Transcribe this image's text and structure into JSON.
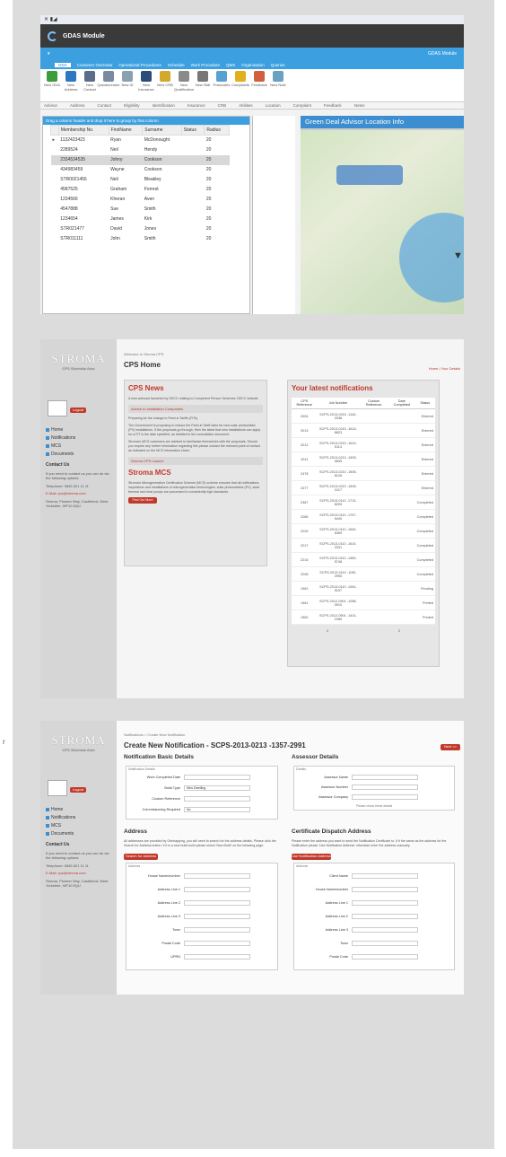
{
  "edge_char": "r",
  "gdas": {
    "window_title": "GDAS Module",
    "banner_right": "GDAS Module",
    "tabs": [
      "GDA",
      "Customer Overview",
      "Operational Procedures",
      "Schedule",
      "Work Procedure",
      "QMS",
      "Organisation",
      "Queries"
    ],
    "ribbon_buttons": [
      {
        "label": "New GDA",
        "color": "#3a9e3a"
      },
      {
        "label": "New Address",
        "color": "#2e78c2"
      },
      {
        "label": "New Contact",
        "color": "#5a6d8a"
      },
      {
        "label": "Questionnaire",
        "color": "#7a8aa0"
      },
      {
        "label": "New ID",
        "color": "#8aa0b0"
      },
      {
        "label": "New Insurance",
        "color": "#2b4c7a"
      },
      {
        "label": "New CRB",
        "color": "#d4a82a"
      },
      {
        "label": "New Qualification",
        "color": "#8a8a8a"
      },
      {
        "label": "New Skill",
        "color": "#777"
      },
      {
        "label": "Postcodes",
        "color": "#5aa0d0"
      },
      {
        "label": "Complaints",
        "color": "#e0b020"
      },
      {
        "label": "Feedback",
        "color": "#d06040"
      },
      {
        "label": "New Note",
        "color": "#6aa0c0"
      }
    ],
    "ribbon_groups": [
      "Advisor",
      "Address",
      "Contact",
      "Eligibility",
      "Identification",
      "Insurance",
      "CRB",
      "Abilities",
      "Location",
      "Complaint",
      "Feedback",
      "Notes"
    ],
    "grid_hint": "Drag a column header and drop it here to group by that column",
    "columns": [
      "Membership No.",
      "FirstName",
      "Surname",
      "Status",
      "Radius"
    ],
    "rows": [
      [
        "1132423423",
        "Ryan",
        "McDonought",
        "20"
      ],
      [
        "2289524",
        "Neil",
        "Hendy",
        "20"
      ],
      [
        "2334534535",
        "Johny",
        "Cookson",
        "20"
      ],
      [
        "434983459",
        "Wayne",
        "Cookson",
        "20"
      ],
      [
        "STR0021456",
        "Neil",
        "Bleakley",
        "20"
      ],
      [
        "4587525",
        "Graham",
        "Forrest",
        "20"
      ],
      [
        "1234566",
        "Kheran",
        "Aven",
        "20"
      ],
      [
        "4547888",
        "Sue",
        "Smith",
        "20"
      ],
      [
        "1234654",
        "James",
        "Kirk",
        "20"
      ],
      [
        "STR021477",
        "David",
        "Jones",
        "20"
      ],
      [
        "STR011111",
        "John",
        "Smith",
        "20"
      ]
    ],
    "map_title": "Green Deal Advisor Location Info"
  },
  "side": {
    "logo": "STROMA",
    "logo_sub": "CPS Stormstar Area",
    "logout": "Logout",
    "nav": [
      "Home",
      "Notifications",
      "MCS",
      "Documents"
    ],
    "contact_title": "Contact Us",
    "contact_lines": [
      "If you need to contact us you can do via the following options:",
      "Telephone: 0845 621 11 11",
      "E-Mail: cps@stroma.com",
      "Stroma, Pioneer Way, Castleford, West Yorkshire, WF10 5QU"
    ]
  },
  "cps_home": {
    "breadcrumb": "Welcome to Stroma CPS",
    "title": "CPS Home",
    "links": "Home  |  Your Details",
    "news_title": "CPS News",
    "news_intro": "A new webcast launched by DECC relating to Competent Person Schemes: DECC website",
    "acc1": "Advice to Installation Companies",
    "news_p1": "Preparing for the change in Feed-in Tariffs (FITs)",
    "news_p2": "The Government is proposing to reduce the Feed-in Tariff rates for new solar photovoltaic (PV) installations. If the proposals go through, then the latest that new installations can apply for a FiT is the date specified, as detailed in the consultation document.",
    "news_p3": "Stroma's MCS customers are advised to familiarise themselves with the proposals. Should you require any further information regarding this please contact the relevant point of contact as indicated on the MCS information sheet.",
    "acc2": "Stroma CPS Launch",
    "mcs_title": "Stroma MCS",
    "mcs_text": "Stroma's Microgeneration Certification Scheme (MCS) scheme ensures that all notifications, inspections and installations of microgeneration technologies, solar photovoltaics (PV), solar thermal and heat pumps are processed to consistently high standards.",
    "find_out_more": "Find Out More",
    "notif_title": "Your latest notifications",
    "notif_cols": [
      "CPS Reference",
      "Job Number",
      "Custom Reference",
      "Date Completed",
      "Status"
    ],
    "notif_rows": [
      [
        "2004",
        "SCPS-2013-0210 -1140-2038",
        "Entered"
      ],
      [
        "2013",
        "SCPS-2013-0210 -1613-8823",
        "Entered"
      ],
      [
        "2012",
        "SCPS-2013-0210 -1613-5114",
        "Entered"
      ],
      [
        "2011",
        "SCPS-2013-0210 -1503-0839",
        "Entered"
      ],
      [
        "2478",
        "SCPS-2013-0210 -1505-6126",
        "Entered"
      ],
      [
        "2477",
        "SCPS-2013-0210 -1505-1017",
        "Entered"
      ],
      [
        "2387",
        "SCPS-2013-0110 -1713-8209",
        "Completed"
      ],
      [
        "2286",
        "SCPS-2013-0110 -1707-9440",
        "Completed"
      ],
      [
        "2226",
        "SCPS-2013-0110 -1540-6369",
        "Completed"
      ],
      [
        "2217",
        "SCPS-2013-0110 -1610-2331",
        "Completed"
      ],
      [
        "2216",
        "SCPS-2013-0110 -1453-5748",
        "Completed"
      ],
      [
        "2208",
        "SCPS-2013-0110 -1150-2995",
        "Completed"
      ],
      [
        "1962",
        "SCPS-2013-0110 -1004-5197",
        "Pending"
      ],
      [
        "1961",
        "SCPS-2012-0901 -1058-0910",
        "Printed"
      ],
      [
        "1960",
        "SCPS-2012-0901 -1401-1989",
        "Printed"
      ]
    ],
    "pager": [
      "1",
      "2"
    ]
  },
  "cps_new": {
    "breadcrumb": "Notifications > Create New Notification",
    "title": "Create New Notification - SCPS-2013-0213 -1357-2991",
    "next_button": "Next >>",
    "basic_title": "Notification Basic Details",
    "basic_legend": "Notification Details",
    "fields": [
      {
        "label": "Work Completed Date",
        "value": ""
      },
      {
        "label": "Build Type",
        "value": "New Dwelling"
      },
      {
        "label": "Custom Reference",
        "value": ""
      },
      {
        "label": "Commissioning Required",
        "value": "No"
      }
    ],
    "assessor_title": "Assessor Details",
    "assessor_legend": "Details",
    "assessor_fields": [
      "Assessor Name",
      "Assessor Number",
      "Assessor Company"
    ],
    "assessor_note": "Please check these details",
    "address_title": "Address",
    "address_blurb": "All addresses are provided by Getmapping, you will need to search for the address details. Please click the Search for Address button. If it is a new build build please select 'New Build' on the following page.",
    "search_button": "Search for Address",
    "address_legend": "Address",
    "address_fields": [
      "House Name/number",
      "Address Line 1",
      "Address Line 2",
      "Address Line 3",
      "Town",
      "Postal Code",
      "UPRN"
    ],
    "dispatch_title": "Certificate Dispatch Address",
    "dispatch_blurb": "Please enter the address you want to send the Notification Certificate to. If it the same as the address for the Notification please 'Use Notification Address' otherwise enter the address manually.",
    "use_button": "Use Notification Address",
    "dispatch_legend": "Address",
    "dispatch_fields": [
      "Client Name",
      "House Name/number",
      "Address Line 1",
      "Address Line 2",
      "Address Line 3",
      "Town",
      "Postal Code"
    ]
  }
}
